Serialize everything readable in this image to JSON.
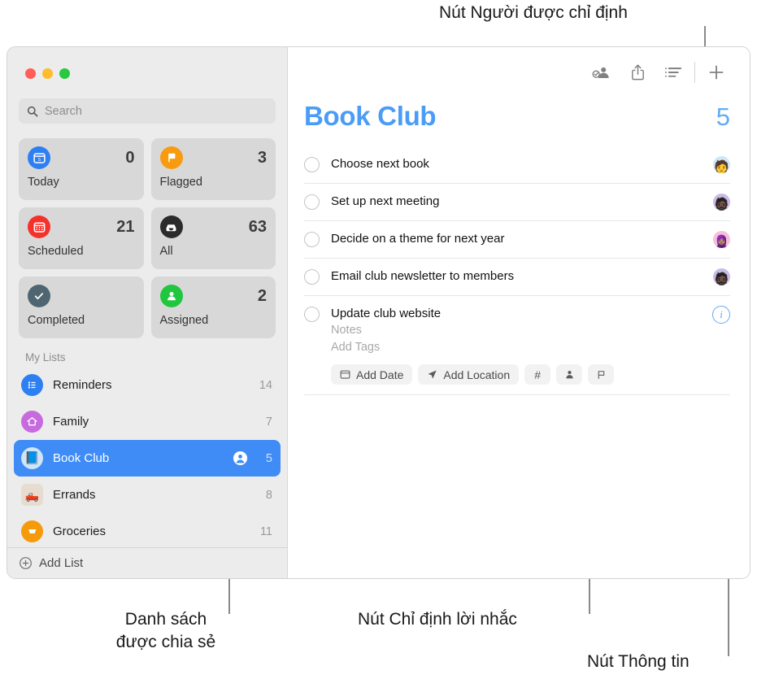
{
  "annotations": [
    {
      "id": "assignee-button",
      "text": "Nút Người được chỉ định"
    },
    {
      "id": "shared-list",
      "text": "Danh sách\nđược chia sẻ"
    },
    {
      "id": "assign-reminder-button",
      "text": "Nút Chỉ định lời nhắc"
    },
    {
      "id": "info-button",
      "text": "Nút Thông tin"
    }
  ],
  "window": {
    "traffic_lights": [
      "close",
      "minimize",
      "zoom"
    ],
    "search": {
      "placeholder": "Search",
      "icon": "search-icon"
    }
  },
  "sidebar": {
    "smart_lists": [
      {
        "label": "Today",
        "count": "0",
        "icon": "calendar-day-icon",
        "color": "#2e7ff2"
      },
      {
        "label": "Flagged",
        "count": "3",
        "icon": "flag-icon",
        "color": "#f89b10"
      },
      {
        "label": "Scheduled",
        "count": "21",
        "icon": "calendar-icon",
        "color": "#f5312b"
      },
      {
        "label": "All",
        "count": "63",
        "icon": "inbox-icon",
        "color": "#2b2b2b"
      },
      {
        "label": "Completed",
        "count": "",
        "icon": "checkmark-icon",
        "color": "#4f6672"
      },
      {
        "label": "Assigned",
        "count": "2",
        "icon": "person-icon",
        "color": "#21c63f"
      }
    ],
    "my_lists_header": "My Lists",
    "lists": [
      {
        "label": "Reminders",
        "count": "14",
        "icon": "bullet-list-icon",
        "color": "#2e7ff2",
        "shape": "circle",
        "shared": false,
        "selected": false
      },
      {
        "label": "Family",
        "count": "7",
        "icon": "house-icon",
        "color": "#c76ae0",
        "shape": "circle",
        "shared": false,
        "selected": false
      },
      {
        "label": "Book Club",
        "count": "5",
        "icon": "book-icon",
        "color": "#cfe4f7",
        "shape": "circle",
        "shared": true,
        "selected": true
      },
      {
        "label": "Errands",
        "count": "8",
        "icon": "truck-icon",
        "color": "#e6ddd0",
        "shape": "square",
        "shared": false,
        "selected": false
      },
      {
        "label": "Groceries",
        "count": "11",
        "icon": "cart-icon",
        "color": "#f59b0b",
        "shape": "circle",
        "shared": false,
        "selected": false
      }
    ],
    "add_list": {
      "label": "Add List",
      "icon": "plus-circle-icon"
    }
  },
  "main": {
    "toolbar": [
      {
        "name": "assignee-button",
        "icon": "person-badge-check-icon"
      },
      {
        "name": "share-button",
        "icon": "share-icon"
      },
      {
        "name": "list-view-button",
        "icon": "list-bullet-icon"
      },
      {
        "name": "add-reminder-button",
        "icon": "plus-icon"
      }
    ],
    "list_title": "Book Club",
    "list_total": "5",
    "title_color": "#4a9cf6",
    "reminders": [
      {
        "title": "Choose next book",
        "avatar": "🧑",
        "avatar_bg": "#cde8f7",
        "expanded": false
      },
      {
        "title": "Set up next meeting",
        "avatar": "🧔🏿",
        "avatar_bg": "#c9bbe8",
        "expanded": false
      },
      {
        "title": "Decide on a theme for next year",
        "avatar": "🧕🏽",
        "avatar_bg": "#f5c0d8",
        "expanded": false
      },
      {
        "title": "Email club newsletter to members",
        "avatar": "🧔🏿",
        "avatar_bg": "#c9bbe8",
        "expanded": false
      },
      {
        "title": "Update club website",
        "avatar": "",
        "avatar_bg": "",
        "expanded": true,
        "notes_placeholder": "Notes",
        "tags_placeholder": "Add Tags",
        "actions": [
          {
            "name": "add-date-button",
            "label": "Add Date",
            "icon": "calendar-icon"
          },
          {
            "name": "add-location-button",
            "label": "Add Location",
            "icon": "location-arrow-icon"
          },
          {
            "name": "add-tag-button",
            "label": "#",
            "icon": "hash-icon"
          },
          {
            "name": "assign-reminder-button",
            "label": "",
            "icon": "person-icon"
          },
          {
            "name": "flag-reminder-button",
            "label": "",
            "icon": "flag-outline-icon"
          }
        ],
        "info_label": "i"
      }
    ]
  }
}
